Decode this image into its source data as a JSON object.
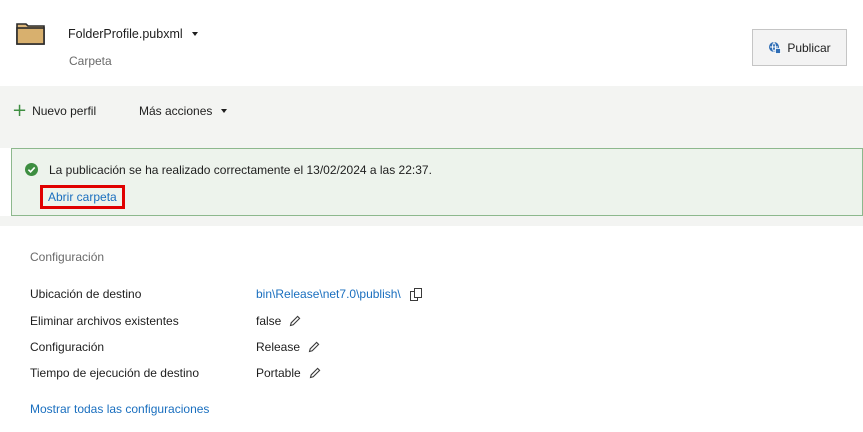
{
  "header": {
    "profile_name": "FolderProfile.pubxml",
    "profile_type": "Carpeta",
    "publish_label": "Publicar"
  },
  "toolbar": {
    "new_profile": "Nuevo perfil",
    "more_actions": "Más acciones"
  },
  "notification": {
    "message": "La publicación se ha realizado correctamente el 13/02/2024 a las 22:37.",
    "open_folder": "Abrir carpeta"
  },
  "settings": {
    "title": "Configuración",
    "rows": [
      {
        "label": "Ubicación de destino",
        "value": "bin\\Release\\net7.0\\publish\\"
      },
      {
        "label": "Eliminar archivos existentes",
        "value": "false"
      },
      {
        "label": "Configuración",
        "value": "Release"
      },
      {
        "label": "Tiempo de ejecución de destino",
        "value": "Portable"
      }
    ],
    "show_all": "Mostrar todas las configuraciones"
  },
  "colors": {
    "link": "#1a6fbf",
    "success_bg": "#edf3ec",
    "success_border": "#8db88d",
    "check": "#3e8e41",
    "highlight": "#e00000"
  },
  "icons": [
    "folder-icon",
    "chevron-down-icon",
    "publish-icon",
    "plus-icon",
    "check-circle-icon",
    "copy-icon",
    "pencil-icon"
  ]
}
